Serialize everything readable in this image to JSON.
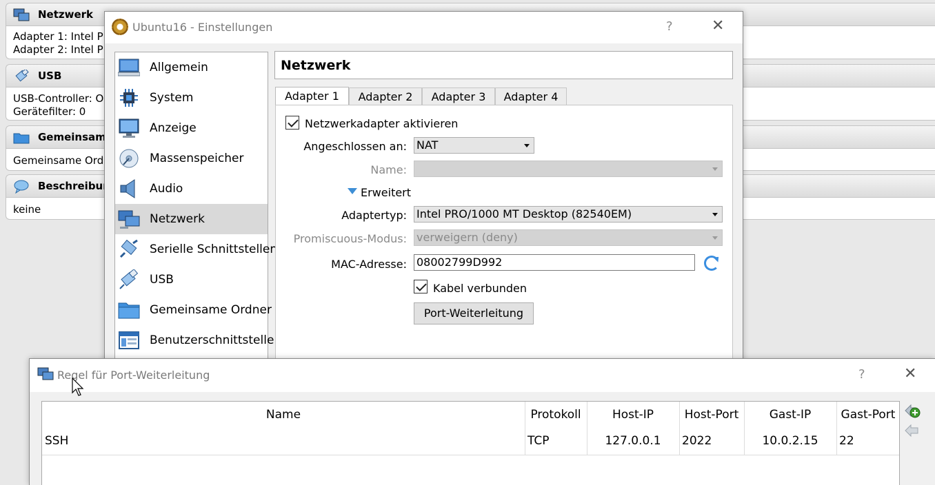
{
  "background": {
    "network": {
      "title": "Netzwerk",
      "rows": [
        "Adapter 1:  Intel P",
        "Adapter 2:  Intel P"
      ]
    },
    "usb": {
      "title": "USB",
      "rows": [
        "USB-Controller:  O",
        "Gerätefilter:       0"
      ]
    },
    "shared": {
      "title": "Gemeinsame",
      "rows": [
        "Gemeinsame Ordn"
      ]
    },
    "description": {
      "title": "Beschreibun",
      "rows": [
        "keine"
      ]
    }
  },
  "settings_dialog": {
    "title": "Ubuntu16 - Einstellungen",
    "help": "?",
    "close": "✕",
    "nav": [
      {
        "label": "Allgemein",
        "icon": "monitor-icon"
      },
      {
        "label": "System",
        "icon": "chip-icon"
      },
      {
        "label": "Anzeige",
        "icon": "display-icon"
      },
      {
        "label": "Massenspeicher",
        "icon": "disk-icon"
      },
      {
        "label": "Audio",
        "icon": "speaker-icon"
      },
      {
        "label": "Netzwerk",
        "icon": "network-icon"
      },
      {
        "label": "Serielle Schnittstellen",
        "icon": "serial-icon"
      },
      {
        "label": "USB",
        "icon": "usb-icon"
      },
      {
        "label": "Gemeinsame Ordner",
        "icon": "folder-icon"
      },
      {
        "label": "Benutzerschnittstelle",
        "icon": "window-icon"
      }
    ],
    "active_nav": "Netzwerk",
    "page_title": "Netzwerk",
    "tabs": [
      "Adapter 1",
      "Adapter 2",
      "Adapter 3",
      "Adapter 4"
    ],
    "active_tab": "Adapter 1",
    "form": {
      "enable_label": "Netzwerkadapter aktivieren",
      "enable_checked": true,
      "attached_label": "Angeschlossen an:",
      "attached_value": "NAT",
      "name_label": "Name:",
      "name_value": "",
      "advanced_label": "Erweitert",
      "adapter_type_label": "Adaptertyp:",
      "adapter_type_value": "Intel PRO/1000 MT Desktop (82540EM)",
      "promisc_label": "Promiscuous-Modus:",
      "promisc_value": "verweigern (deny)",
      "mac_label": "MAC-Adresse:",
      "mac_value": "08002799D992",
      "cable_label": "Kabel verbunden",
      "cable_checked": true,
      "port_forward_button": "Port-Weiterleitung"
    }
  },
  "port_dialog": {
    "title": "Regel für Port-Weiterleitung",
    "help": "?",
    "close": "✕",
    "columns": [
      "Name",
      "Protokoll",
      "Host-IP",
      "Host-Port",
      "Gast-IP",
      "Gast-Port"
    ],
    "rows": [
      {
        "name": "SSH",
        "protocol": "TCP",
        "host_ip": "127.0.0.1",
        "host_port": "2022",
        "guest_ip": "10.0.2.15",
        "guest_port": "22"
      }
    ]
  },
  "colors": {
    "accent": "#3a8ee0",
    "selection": "#d9d9d9",
    "add_green": "#3f9b2f"
  }
}
